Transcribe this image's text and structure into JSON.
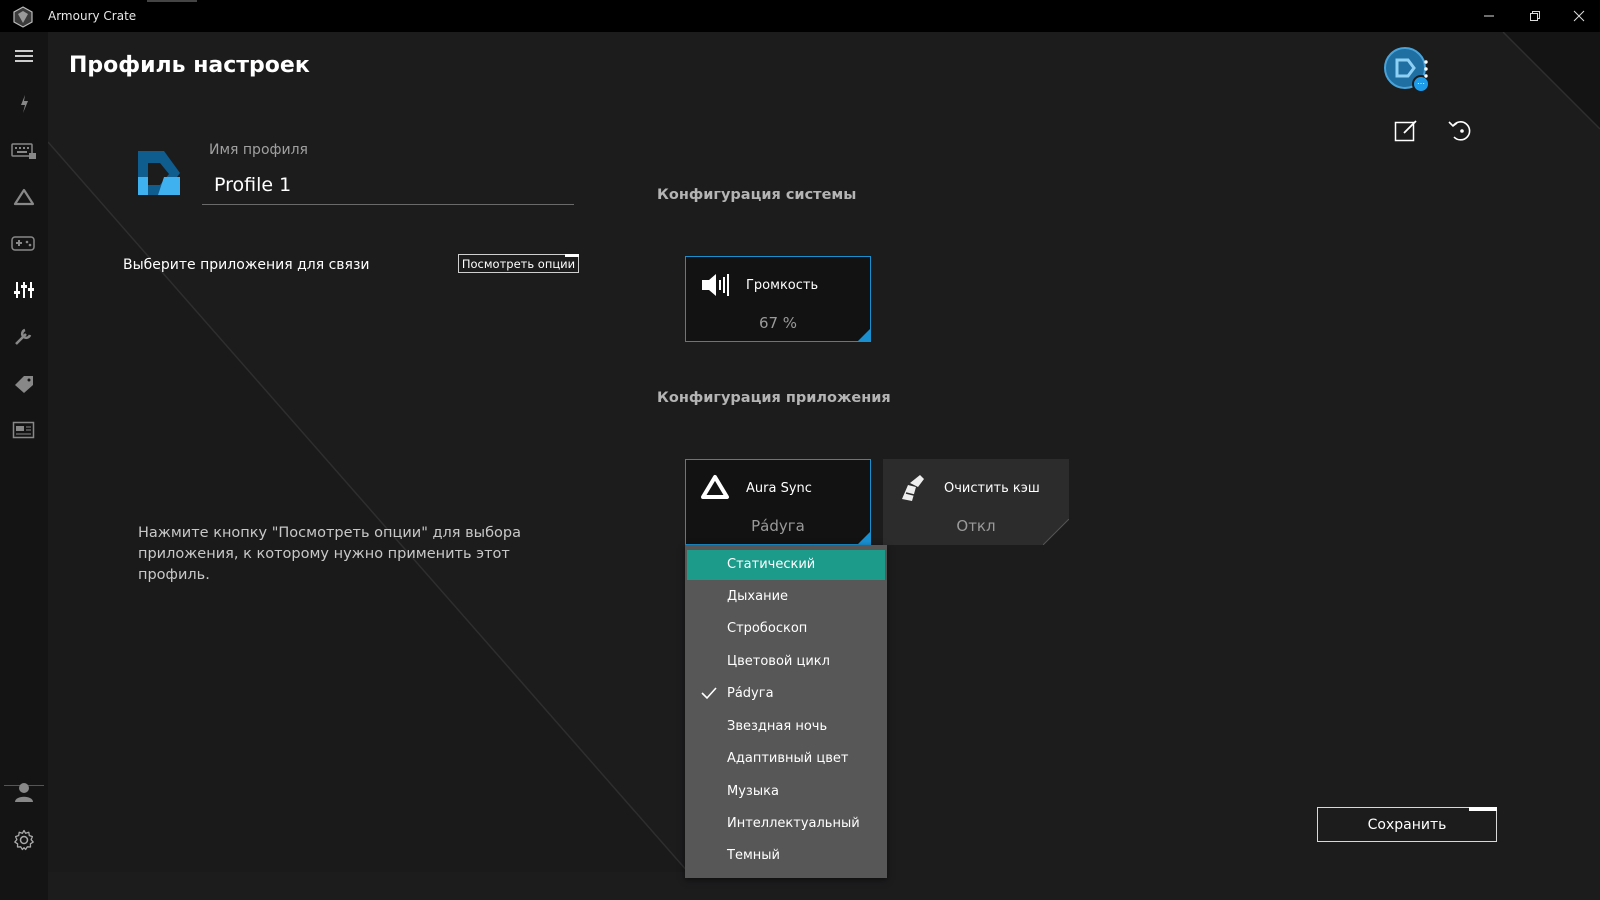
{
  "window": {
    "app_title": "Armoury Crate",
    "controls": [
      "minimize-icon",
      "restore-icon",
      "close-icon"
    ]
  },
  "sidebar": {
    "items": [
      {
        "name": "menu-icon"
      },
      {
        "name": "device-icon"
      },
      {
        "name": "keyboard-icon"
      },
      {
        "name": "aura-icon"
      },
      {
        "name": "gamepad-icon"
      },
      {
        "name": "scenario-profiles-icon",
        "active": true
      },
      {
        "name": "tools-icon"
      },
      {
        "name": "deals-icon"
      },
      {
        "name": "news-icon"
      }
    ],
    "bottom": [
      {
        "name": "user-icon"
      },
      {
        "name": "settings-icon"
      }
    ]
  },
  "header": {
    "title": "Профиль настроек"
  },
  "profile": {
    "name_label": "Имя профиля",
    "name_value": "Profile 1",
    "link_label": "Выберите приложения для связи",
    "view_options_label": "Посмотреть опции",
    "hint": "Нажмите кнопку \"Посмотреть опции\" для выбора приложения, к которому нужно применить этот профиль."
  },
  "system_config": {
    "title": "Конфигурация системы",
    "volume": {
      "label": "Громкость",
      "value": "67 %"
    }
  },
  "app_config": {
    "title": "Конфигурация приложения",
    "aura": {
      "label": "Aura Sync",
      "value": "Рádуга"
    },
    "cache": {
      "label": "Очистить кэш",
      "value": "Откл"
    }
  },
  "aura_dropdown": {
    "items": [
      {
        "label": "Статический",
        "highlighted": true
      },
      {
        "label": "Дыхание"
      },
      {
        "label": "Стробоскоп"
      },
      {
        "label": "Цветовой цикл"
      },
      {
        "label": "Рádуга",
        "checked": true
      },
      {
        "label": "Звездная ночь"
      },
      {
        "label": "Адаптивный цвет"
      },
      {
        "label": "Музыка"
      },
      {
        "label": "Интеллектуальный"
      },
      {
        "label": "Темный"
      }
    ]
  },
  "footer": {
    "save_label": "Сохранить"
  },
  "colors": {
    "accent_blue": "#1a8fd0",
    "highlight_teal": "#1c9b8b",
    "background": "#1c1c1d"
  }
}
